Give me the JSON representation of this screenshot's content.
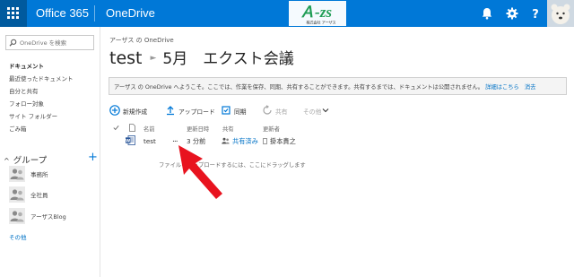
{
  "suite": {
    "brand": "Office 365",
    "app": "OneDrive",
    "logo_text": "ア-zs",
    "logo_sub": "株式会社 アーザス"
  },
  "search": {
    "placeholder": "OneDrive を検索"
  },
  "nav": {
    "items": [
      {
        "label": "ドキュメント",
        "active": true
      },
      {
        "label": "最近使ったドキュメント"
      },
      {
        "label": "自分と共有"
      },
      {
        "label": "フォロー対象"
      },
      {
        "label": "サイト フォルダー"
      },
      {
        "label": "ごみ箱"
      }
    ],
    "groups_title": "グループ",
    "groups_add": "+",
    "groups": [
      {
        "label": "事務所"
      },
      {
        "label": "全社員"
      },
      {
        "label": "アーザスBlog"
      }
    ],
    "more": "その他"
  },
  "main": {
    "breadcrumb_owner": "アーザス の OneDrive",
    "breadcrumb": [
      "test",
      "5月　エクスト会議"
    ],
    "notice": {
      "text": "アーザス の OneDrive へようこそ。ここでは、作業を保存、同期、共有することができます。共有するまでは、ドキュメントは公開されません。",
      "details_link": "詳細はこちら",
      "dismiss_link": "消去"
    },
    "commands": {
      "new": "新規作成",
      "upload": "アップロード",
      "sync": "同期",
      "share": "共有",
      "more": "その他"
    },
    "columns": {
      "name": "名前",
      "modified": "更新日時",
      "sharing": "共有",
      "modified_by": "更新者"
    },
    "file": {
      "name": "test",
      "ellipsis": "...",
      "modified": "3 分前",
      "sharing": "共有済み",
      "modified_by": "掛本貴之"
    },
    "dropzone": "ファイルをアップロードするには、ここにドラッグします"
  },
  "colors": {
    "suitebar": "#0078d7",
    "link": "#0072c6",
    "arrow": "#e8131f"
  }
}
